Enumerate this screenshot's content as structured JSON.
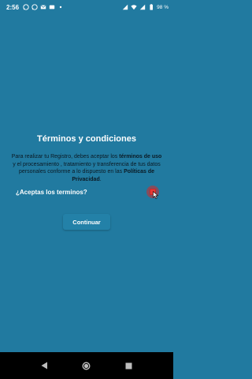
{
  "status_bar": {
    "time": "2:56",
    "battery": "98 %",
    "left_icons": [
      "whatsapp-icon",
      "whatsapp-icon",
      "gmail-icon",
      "tv-icon",
      "notification-dot-icon"
    ],
    "right_icons": [
      "signal-icon",
      "wifi-icon",
      "signal-bars-icon",
      "battery-icon"
    ]
  },
  "dialog": {
    "title": "Términos y condiciones",
    "body_part1": "Para realizar tu Registro, debes aceptar los ",
    "body_bold1": "términos de uso",
    "body_part2": " y el procesamiento , tratamiento y transferencia de tus datos personales conforme a lo dispuesto en las ",
    "body_bold2": "Políticas de Privacidad",
    "body_end": ".",
    "accept_label": "¿Aceptas los terminos?",
    "accept_checked": false,
    "continue_label": "Continuar"
  },
  "nav_bar": {
    "buttons": [
      "back-icon",
      "home-icon",
      "recents-icon"
    ]
  },
  "colors": {
    "background": "#217aa0",
    "checkbox": "#e53935",
    "nav_background": "#000000"
  }
}
